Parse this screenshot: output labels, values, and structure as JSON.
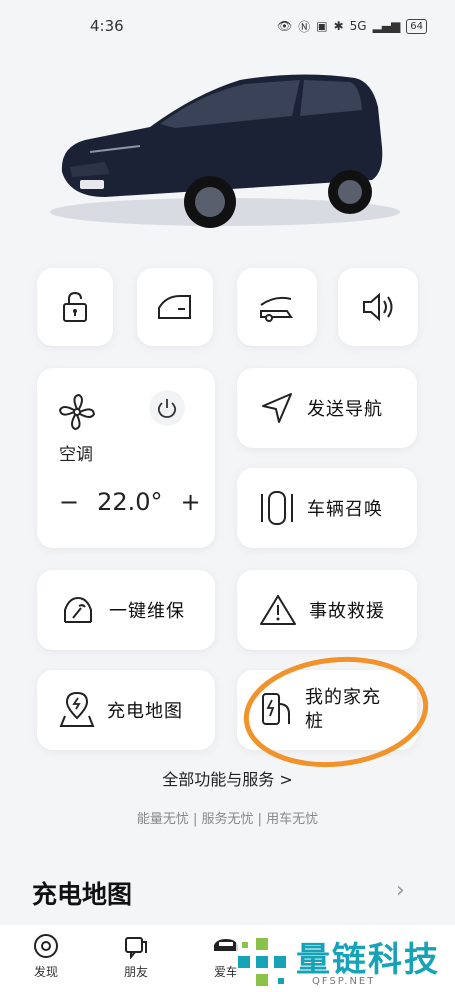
{
  "status_bar": {
    "time": "4:36",
    "signal_text": "5G",
    "battery": "64"
  },
  "quick_controls": [
    {
      "name": "lock-icon"
    },
    {
      "name": "car-door-icon"
    },
    {
      "name": "trunk-icon"
    },
    {
      "name": "speaker-icon"
    }
  ],
  "climate": {
    "label": "空调",
    "temperature": "22.0°",
    "minus": "−",
    "plus": "+"
  },
  "features": {
    "send_nav": "发送导航",
    "summon": "车辆召唤",
    "maintenance": "一键维保",
    "rescue": "事故救援",
    "charge_map": "充电地图",
    "home_charger": "我的家充桩"
  },
  "all_services": "全部功能与服务 >",
  "tagline": "能量无忧 | 服务无忧 | 用车无忧",
  "section_title": "充电地图",
  "tabs": [
    {
      "label": "发现",
      "icon": "discover-icon"
    },
    {
      "label": "朋友",
      "icon": "chat-icon"
    },
    {
      "label": "爱车",
      "icon": "car-icon"
    }
  ],
  "watermark": {
    "text": "量链科技",
    "sub": "QFSP.NET"
  },
  "colors": {
    "accent_orange": "#f2922a",
    "watermark_teal": "#16a3b8",
    "car_body": "#1c2236"
  }
}
